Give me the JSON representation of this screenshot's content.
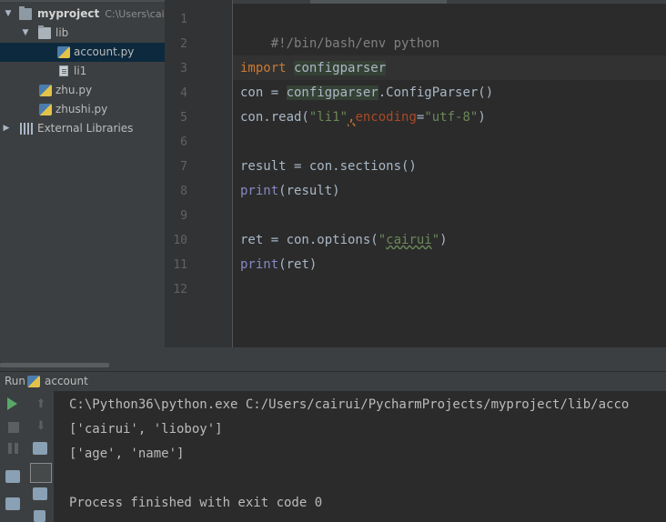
{
  "project": {
    "root_name": "myproject",
    "root_path": "C:\\Users\\cai",
    "items": [
      {
        "label": "lib",
        "type": "folder"
      },
      {
        "label": "account.py",
        "type": "python"
      },
      {
        "label": "li1",
        "type": "text"
      },
      {
        "label": "zhu.py",
        "type": "python"
      },
      {
        "label": "zhushi.py",
        "type": "python"
      },
      {
        "label": "External Libraries",
        "type": "libraries"
      }
    ]
  },
  "editor": {
    "line_numbers": [
      "1",
      "2",
      "3",
      "4",
      "5",
      "6",
      "7",
      "8",
      "9",
      "10",
      "11",
      "12"
    ],
    "code": {
      "l1": "#!/bin/bash/env python",
      "l3_kw": "import",
      "l3_mod": "configparser",
      "l4_a": "con = ",
      "l4_mod": "configparser",
      "l4_b": ".ConfigParser()",
      "l5_a": "con.read(",
      "l5_str": "\"li1\"",
      "l5_comma": ",",
      "l5_param": "encoding",
      "l5_eq": "=",
      "l5_str2": "\"utf-8\"",
      "l5_close": ")",
      "l7": "result = con.sections()",
      "l8_fn": "print",
      "l8_arg": "(result)",
      "l10_a": "ret = con.options(",
      "l10_q1": "\"",
      "l10_str": "cairui",
      "l10_q2": "\"",
      "l10_close": ")",
      "l11_fn": "print",
      "l11_arg": "(ret)"
    }
  },
  "run": {
    "label": "Run",
    "config_name": "account",
    "console": [
      "C:\\Python36\\python.exe C:/Users/cairui/PycharmProjects/myproject/lib/acco",
      "['cairui', 'lioboy']",
      "['age', 'name']",
      "",
      "Process finished with exit code 0"
    ]
  },
  "colors": {
    "keyword": "#cc7832",
    "string": "#6a8759",
    "comment": "#808080",
    "builtin": "#8888c6",
    "run_green": "#59a869"
  }
}
